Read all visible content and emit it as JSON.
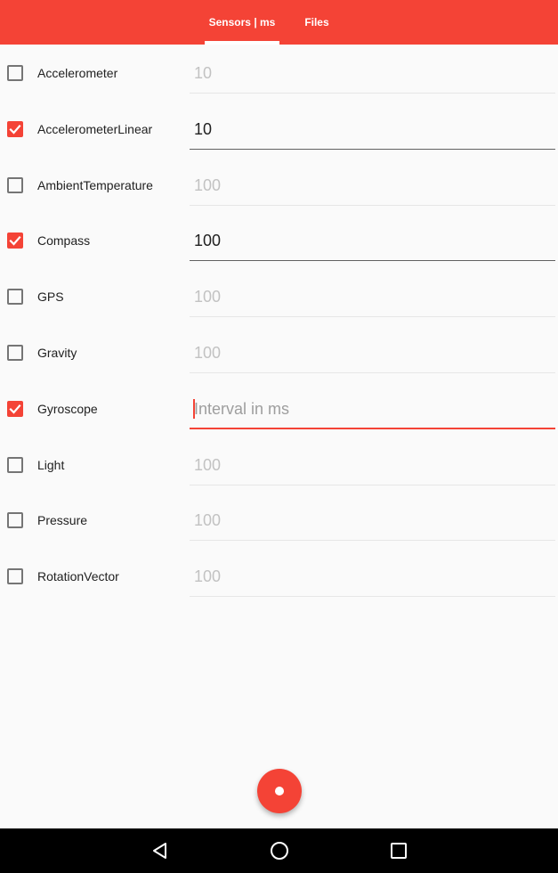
{
  "tabs": [
    {
      "label": "Sensors | ms",
      "selected": true
    },
    {
      "label": "Files",
      "selected": false
    }
  ],
  "field_placeholder": "Interval in ms",
  "sensors": [
    {
      "name": "Accelerometer",
      "checked": false,
      "value": "10"
    },
    {
      "name": "AccelerometerLinear",
      "checked": true,
      "value": "10"
    },
    {
      "name": "AmbientTemperature",
      "checked": false,
      "value": "100"
    },
    {
      "name": "Compass",
      "checked": true,
      "value": "100"
    },
    {
      "name": "GPS",
      "checked": false,
      "value": "100"
    },
    {
      "name": "Gravity",
      "checked": false,
      "value": "100"
    },
    {
      "name": "Gyroscope",
      "checked": true,
      "value": "",
      "focused": true
    },
    {
      "name": "Light",
      "checked": false,
      "value": "100"
    },
    {
      "name": "Pressure",
      "checked": false,
      "value": "100"
    },
    {
      "name": "RotationVector",
      "checked": false,
      "value": "100"
    }
  ],
  "fab": {
    "icon": "record-icon"
  },
  "navbar": {
    "icons": [
      "back-icon",
      "home-icon",
      "recents-icon"
    ]
  },
  "colors": {
    "accent": "#f44336",
    "app_bar": "#f44336",
    "background": "#fafafa",
    "nav_bar": "#000000"
  }
}
